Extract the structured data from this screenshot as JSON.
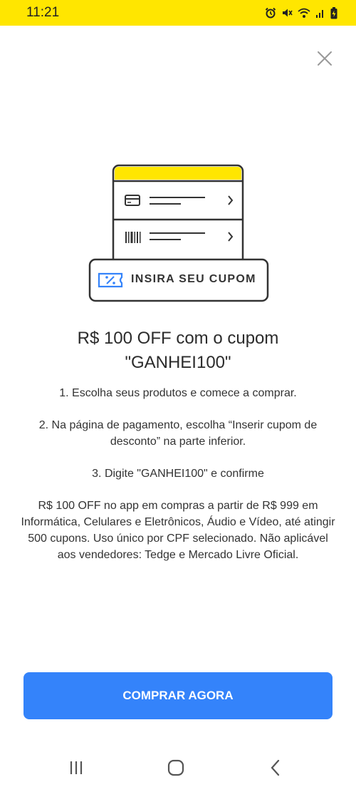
{
  "status_bar": {
    "time": "11:21",
    "icons": [
      "alarm-icon",
      "mute-icon",
      "wifi-icon",
      "signal-icon",
      "battery-icon"
    ],
    "background": "#ffe600"
  },
  "close_icon": "close-icon",
  "illustration": {
    "coupon_label": "INSIRA SEU CUPOM",
    "rows": [
      {
        "icon": "credit-card-icon"
      },
      {
        "icon": "barcode-icon"
      }
    ],
    "coupon_icon": "coupon-ticket-icon"
  },
  "title": {
    "line1": "R$ 100 OFF com o cupom",
    "line2": "\"GANHEI100\""
  },
  "steps": [
    "1. Escolha seus produtos e comece a comprar.",
    "2. Na página de pagamento, escolha “Inserir cupom de desconto” na parte inferior.",
    "3. Digite \"GANHEI100\" e confirme"
  ],
  "terms": "R$ 100 OFF no app em compras a partir de R$ 999 em Informática, Celulares e Eletrônicos, Áudio e Vídeo, até atingir 500 cupons. Uso único por CPF selecionado. Não aplicável aos vendedores: Tedge e Mercado Livre Oficial.",
  "cta": {
    "label": "COMPRAR AGORA",
    "color": "#3483fa"
  },
  "nav": {
    "icons": [
      "recent-apps-icon",
      "home-icon",
      "back-icon"
    ]
  }
}
